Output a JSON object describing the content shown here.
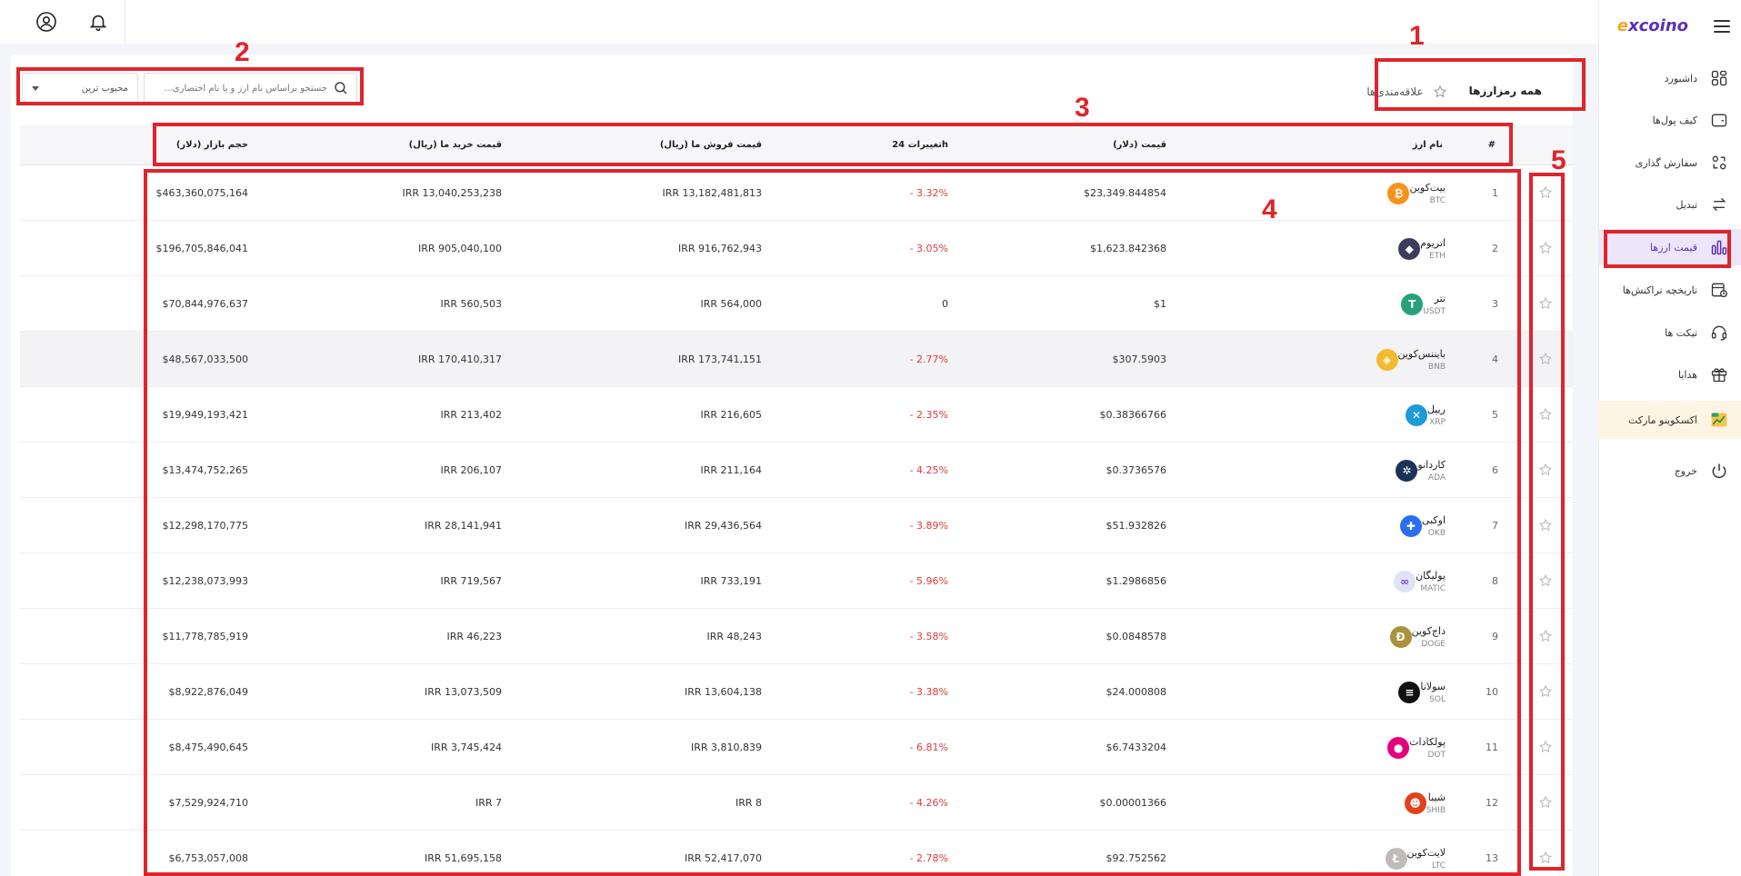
{
  "brand": {
    "logo_prefix": "e",
    "logo_text": "xcoino"
  },
  "colors": {
    "accent": "#5b2fb5",
    "negative": "#e03b3b",
    "annotation": "#e0242c"
  },
  "topbar": {
    "icons": [
      "user-icon",
      "bell-icon"
    ]
  },
  "sidebar": {
    "items": [
      {
        "label": "داشبورد",
        "icon": "dashboard-icon"
      },
      {
        "label": "کیف پول‌ها",
        "icon": "wallet-icon"
      },
      {
        "label": "سفارش گذاری",
        "icon": "order-icon"
      },
      {
        "label": "تبدیل",
        "icon": "exchange-icon"
      },
      {
        "label": "قیمت ارزها",
        "icon": "chart-bars-icon",
        "active": true
      },
      {
        "label": "تاریخچه تراکنش‌ها",
        "icon": "history-icon"
      },
      {
        "label": "تیکت ها",
        "icon": "headset-icon"
      },
      {
        "label": "هدایا",
        "icon": "gift-icon"
      },
      {
        "label": "اکسکوینو مارکت",
        "icon": "market-icon"
      },
      {
        "label": "خروج",
        "icon": "power-icon"
      }
    ]
  },
  "tabs": [
    {
      "label": "همه رمزارزها",
      "active": true
    },
    {
      "label": "علاقه‌مندی‌ها",
      "active": false
    }
  ],
  "search": {
    "placeholder": "جستجو براساس نام ارز و یا نام اختصاری..."
  },
  "sort": {
    "value": "محبوب ترین"
  },
  "table": {
    "headers": {
      "index": "#",
      "name": "نام ارز",
      "price_usd": "قیمت (دلار)",
      "change_24h": "تغییرات 24h",
      "sell": "قیمت فروش ما (ریال)",
      "buy": "قیمت خرید ما (ریال)",
      "market_cap": "حجم بازار (دلار)"
    },
    "rows": [
      {
        "index": "1",
        "name": "بیت‌کوین",
        "symbol": "BTC",
        "price": "$23,349.844854",
        "change": "- 3.32%",
        "sell": "IRR 13,182,481,813",
        "buy": "IRR 13,040,253,238",
        "cap": "$463,360,075,164",
        "icon_color": "#f7931a",
        "glyph": "₿"
      },
      {
        "index": "2",
        "name": "اتریوم",
        "symbol": "ETH",
        "price": "$1,623.842368",
        "change": "- 3.05%",
        "sell": "IRR 916,762,943",
        "buy": "IRR 905,040,100",
        "cap": "$196,705,846,041",
        "icon_color": "#3c3c5d",
        "glyph": "◆"
      },
      {
        "index": "3",
        "name": "تتر",
        "symbol": "USDT",
        "price": "$1",
        "change": "0",
        "sell": "IRR 564,000",
        "buy": "IRR 560,503",
        "cap": "$70,844,976,637",
        "icon_color": "#26a17b",
        "glyph": "T"
      },
      {
        "index": "4",
        "name": "بایننس‌کوین",
        "symbol": "BNB",
        "price": "$307.5903",
        "change": "- 2.77%",
        "sell": "IRR 173,741,151",
        "buy": "IRR 170,410,317",
        "cap": "$48,567,033,500",
        "icon_color": "#f3ba2f",
        "glyph": "◈"
      },
      {
        "index": "5",
        "name": "ریپل",
        "symbol": "XRP",
        "price": "$0.38366766",
        "change": "- 2.35%",
        "sell": "IRR 216,605",
        "buy": "IRR 213,402",
        "cap": "$19,949,193,421",
        "icon_color": "#1e9bd7",
        "glyph": "✕"
      },
      {
        "index": "6",
        "name": "کاردانو",
        "symbol": "ADA",
        "price": "$0.3736576",
        "change": "- 4.25%",
        "sell": "IRR 211,164",
        "buy": "IRR 206,107",
        "cap": "$13,474,752,265",
        "icon_color": "#1b3357",
        "glyph": "✲"
      },
      {
        "index": "7",
        "name": "اوکبی",
        "symbol": "OKB",
        "price": "$51.932826",
        "change": "- 3.89%",
        "sell": "IRR 29,436,564",
        "buy": "IRR 28,141,941",
        "cap": "$12,298,170,775",
        "icon_color": "#2a6ff0",
        "glyph": "✚"
      },
      {
        "index": "8",
        "name": "پولیگان",
        "symbol": "MATIC",
        "price": "$1.2986856",
        "change": "- 5.96%",
        "sell": "IRR 733,191",
        "buy": "IRR 719,567",
        "cap": "$12,238,073,993",
        "icon_color": "#dfe3f4",
        "glyph": "∞"
      },
      {
        "index": "9",
        "name": "داج‌کوین",
        "symbol": "DOGE",
        "price": "$0.0848578",
        "change": "- 3.58%",
        "sell": "IRR 48,243",
        "buy": "IRR 46,223",
        "cap": "$11,778,785,919",
        "icon_color": "#a8923b",
        "glyph": "Ð"
      },
      {
        "index": "10",
        "name": "سولانا",
        "symbol": "SOL",
        "price": "$24.000808",
        "change": "- 3.38%",
        "sell": "IRR 13,604,138",
        "buy": "IRR 13,073,509",
        "cap": "$8,922,876,049",
        "icon_color": "#111111",
        "glyph": "≡"
      },
      {
        "index": "11",
        "name": "پولکادات",
        "symbol": "DOT",
        "price": "$6.7433204",
        "change": "- 6.81%",
        "sell": "IRR 3,810,839",
        "buy": "IRR 3,745,424",
        "cap": "$8,475,490,645",
        "icon_color": "#e6007a",
        "glyph": "●"
      },
      {
        "index": "12",
        "name": "شیبا",
        "symbol": "SHIB",
        "price": "$0.00001366",
        "change": "- 4.26%",
        "sell": "IRR 8",
        "buy": "IRR 7",
        "cap": "$7,529,924,710",
        "icon_color": "#e2421a",
        "glyph": "☻"
      },
      {
        "index": "13",
        "name": "لایت‌کوین",
        "symbol": "LTC",
        "price": "$92.752562",
        "change": "- 2.78%",
        "sell": "IRR 52,417,070",
        "buy": "IRR 51,695,158",
        "cap": "$6,753,057,008",
        "icon_color": "#bfbbbb",
        "glyph": "Ł"
      }
    ]
  },
  "annotations": [
    "1",
    "2",
    "3",
    "4",
    "5"
  ]
}
